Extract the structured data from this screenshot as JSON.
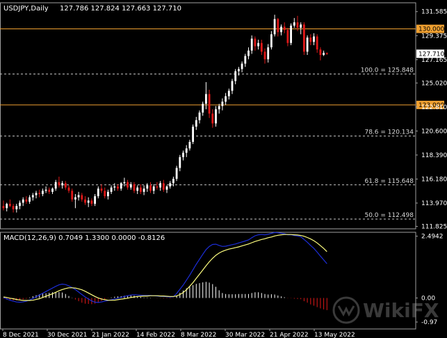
{
  "header": {
    "title": "USDJPY,Daily",
    "ohlc": "127.786 127.824 127.663 127.710"
  },
  "macd_header": "MACD(12,26,9) 0.7049 1.3300 0.0000 -0.8126",
  "watermark": "WikiFX",
  "colors": {
    "background": "#000000",
    "bull": "#ffffff",
    "bear": "#e01818",
    "hline": "#f0a030",
    "grid": "#a0a0a0",
    "macd_line": "#1c2ed8",
    "signal_line": "#ffff80",
    "hist_pos": "#ffffff",
    "hist_neg": "#e01818",
    "price_tag": "#f0a030"
  },
  "chart_data": [
    {
      "type": "candlestick",
      "symbol": "USDJPY",
      "timeframe": "Daily",
      "ylim": [
        111.6,
        132.4
      ],
      "y_ticks": [
        "131.585",
        "129.375",
        "127.165",
        "125.020",
        "122.810",
        "120.600",
        "118.390",
        "116.180",
        "113.970",
        "111.825"
      ],
      "x_ticks": [
        "8 Dec 2021",
        "30 Dec 2021",
        "21 Jan 2022",
        "14 Feb 2022",
        "8 Mar 2022",
        "30 Mar 2022",
        "21 Apr 2022",
        "13 May 2022"
      ],
      "current_price": "127.710",
      "horizontal_lines": [
        {
          "value": 130.0,
          "label": "130.000",
          "style": "solid"
        },
        {
          "value": 123.0,
          "label": "123.000",
          "style": "solid"
        }
      ],
      "fib_levels": [
        {
          "value": 125.848,
          "label": "100.0 = 125.848"
        },
        {
          "value": 120.134,
          "label": "78.6 = 120.134"
        },
        {
          "value": 115.648,
          "label": "61.8 = 115.648"
        },
        {
          "value": 112.498,
          "label": "50.0 = 112.498"
        }
      ],
      "candles": [
        [
          113.7,
          114.2,
          113.3,
          113.5
        ],
        [
          113.5,
          114.0,
          113.2,
          113.9
        ],
        [
          113.9,
          114.3,
          113.6,
          113.7
        ],
        [
          113.7,
          113.9,
          113.1,
          113.4
        ],
        [
          113.4,
          113.9,
          113.1,
          113.7
        ],
        [
          113.7,
          114.2,
          113.4,
          114.0
        ],
        [
          114.0,
          114.5,
          113.7,
          114.3
        ],
        [
          114.3,
          114.6,
          113.9,
          114.1
        ],
        [
          114.1,
          114.7,
          113.9,
          114.5
        ],
        [
          114.5,
          114.9,
          114.2,
          114.7
        ],
        [
          114.7,
          115.1,
          114.4,
          114.9
        ],
        [
          114.9,
          115.2,
          114.5,
          114.8
        ],
        [
          114.8,
          115.3,
          114.6,
          115.1
        ],
        [
          115.1,
          115.5,
          114.9,
          115.2
        ],
        [
          115.2,
          115.4,
          114.8,
          115.0
        ],
        [
          115.0,
          115.4,
          114.8,
          115.3
        ],
        [
          115.3,
          116.1,
          115.1,
          115.9
        ],
        [
          115.9,
          116.4,
          115.4,
          115.6
        ],
        [
          115.6,
          116.0,
          115.3,
          115.8
        ],
        [
          115.8,
          116.0,
          115.2,
          115.4
        ],
        [
          115.4,
          115.6,
          114.9,
          115.1
        ],
        [
          115.1,
          115.3,
          114.1,
          114.3
        ],
        [
          114.3,
          114.8,
          113.5,
          114.5
        ],
        [
          114.5,
          115.0,
          114.2,
          114.7
        ],
        [
          114.7,
          114.9,
          114.1,
          114.3
        ],
        [
          114.3,
          114.6,
          113.8,
          114.0
        ],
        [
          114.0,
          114.5,
          113.6,
          114.2
        ],
        [
          114.2,
          114.4,
          113.7,
          113.9
        ],
        [
          113.9,
          114.8,
          113.7,
          114.6
        ],
        [
          114.6,
          115.5,
          114.4,
          115.3
        ],
        [
          115.3,
          115.7,
          114.9,
          115.1
        ],
        [
          115.1,
          115.4,
          114.4,
          114.6
        ],
        [
          114.6,
          115.2,
          114.3,
          115.0
        ],
        [
          115.0,
          115.6,
          114.8,
          115.4
        ],
        [
          115.4,
          115.8,
          115.1,
          115.5
        ],
        [
          115.5,
          115.7,
          115.1,
          115.3
        ],
        [
          115.3,
          115.9,
          115.1,
          115.8
        ],
        [
          115.8,
          116.3,
          115.5,
          115.9
        ],
        [
          115.9,
          116.1,
          115.2,
          115.4
        ],
        [
          115.4,
          115.9,
          115.2,
          115.7
        ],
        [
          115.7,
          115.9,
          114.9,
          115.1
        ],
        [
          115.1,
          115.6,
          114.8,
          115.4
        ],
        [
          115.4,
          115.7,
          114.8,
          115.0
        ],
        [
          115.0,
          115.6,
          114.7,
          115.3
        ],
        [
          115.3,
          115.8,
          115.0,
          115.6
        ],
        [
          115.6,
          115.9,
          114.9,
          115.1
        ],
        [
          115.1,
          115.7,
          114.8,
          115.5
        ],
        [
          115.5,
          115.9,
          115.2,
          115.4
        ],
        [
          115.4,
          116.0,
          115.1,
          115.8
        ],
        [
          115.8,
          116.1,
          115.0,
          115.2
        ],
        [
          115.2,
          115.6,
          114.9,
          115.5
        ],
        [
          115.5,
          116.0,
          115.3,
          115.8
        ],
        [
          115.8,
          116.4,
          115.5,
          116.2
        ],
        [
          116.2,
          117.4,
          116.0,
          117.2
        ],
        [
          117.2,
          118.4,
          116.9,
          118.2
        ],
        [
          118.2,
          118.8,
          117.9,
          118.6
        ],
        [
          118.6,
          119.3,
          118.2,
          119.0
        ],
        [
          119.0,
          119.8,
          118.8,
          119.6
        ],
        [
          119.6,
          121.2,
          119.4,
          121.0
        ],
        [
          121.0,
          121.9,
          120.7,
          121.6
        ],
        [
          121.6,
          122.5,
          121.3,
          122.3
        ],
        [
          122.3,
          123.3,
          122.0,
          123.1
        ],
        [
          123.1,
          125.1,
          122.6,
          124.0
        ],
        [
          124.0,
          124.4,
          121.8,
          122.2
        ],
        [
          122.2,
          122.6,
          120.9,
          121.3
        ],
        [
          121.3,
          122.9,
          121.0,
          122.6
        ],
        [
          122.6,
          123.1,
          122.2,
          122.9
        ],
        [
          122.9,
          123.6,
          122.5,
          123.3
        ],
        [
          123.3,
          124.1,
          123.0,
          123.8
        ],
        [
          123.8,
          124.5,
          123.5,
          124.3
        ],
        [
          124.3,
          125.4,
          124.0,
          125.2
        ],
        [
          125.2,
          126.3,
          124.9,
          126.1
        ],
        [
          126.1,
          126.5,
          125.7,
          126.3
        ],
        [
          126.3,
          127.0,
          126.0,
          126.8
        ],
        [
          126.8,
          127.7,
          126.5,
          127.5
        ],
        [
          127.5,
          128.3,
          127.2,
          128.0
        ],
        [
          128.0,
          129.4,
          127.7,
          129.1
        ],
        [
          129.1,
          129.3,
          128.0,
          128.4
        ],
        [
          128.4,
          129.0,
          128.1,
          128.7
        ],
        [
          128.7,
          129.0,
          127.6,
          127.9
        ],
        [
          127.9,
          128.2,
          126.8,
          127.2
        ],
        [
          127.2,
          128.6,
          126.9,
          128.3
        ],
        [
          128.3,
          129.8,
          128.1,
          129.5
        ],
        [
          129.5,
          131.3,
          129.3,
          130.9
        ],
        [
          130.9,
          131.0,
          129.3,
          129.7
        ],
        [
          129.7,
          130.4,
          129.4,
          130.2
        ],
        [
          130.2,
          130.6,
          129.6,
          129.9
        ],
        [
          129.9,
          130.1,
          128.4,
          128.7
        ],
        [
          128.7,
          130.5,
          128.5,
          130.3
        ],
        [
          130.3,
          131.0,
          130.1,
          130.6
        ],
        [
          130.6,
          131.2,
          129.8,
          130.1
        ],
        [
          130.1,
          130.6,
          129.5,
          130.4
        ],
        [
          130.4,
          130.6,
          127.6,
          127.9
        ],
        [
          127.9,
          129.4,
          127.6,
          129.2
        ],
        [
          129.2,
          129.5,
          128.5,
          128.8
        ],
        [
          128.8,
          129.6,
          128.5,
          129.3
        ],
        [
          129.3,
          129.5,
          127.8,
          128.1
        ],
        [
          128.1,
          128.3,
          127.1,
          127.6
        ],
        [
          127.6,
          128.0,
          127.5,
          127.8
        ],
        [
          127.8,
          127.8,
          127.6,
          127.7
        ]
      ]
    },
    {
      "type": "macd",
      "params": "12,26,9",
      "ylim": [
        -1.25,
        2.65
      ],
      "y_ticks": [
        "2.4942",
        "0.00",
        "-0.97"
      ],
      "macd": [
        0.02,
        -0.04,
        -0.09,
        -0.13,
        -0.16,
        -0.17,
        -0.16,
        -0.13,
        -0.08,
        -0.02,
        0.05,
        0.12,
        0.19,
        0.26,
        0.33,
        0.4,
        0.47,
        0.53,
        0.56,
        0.54,
        0.49,
        0.42,
        0.34,
        0.24,
        0.14,
        0.04,
        -0.04,
        -0.12,
        -0.17,
        -0.18,
        -0.16,
        -0.13,
        -0.1,
        -0.07,
        -0.04,
        -0.01,
        0.02,
        0.06,
        0.09,
        0.12,
        0.13,
        0.12,
        0.11,
        0.1,
        0.1,
        0.1,
        0.09,
        0.08,
        0.07,
        0.06,
        0.05,
        0.04,
        0.05,
        0.18,
        0.35,
        0.52,
        0.72,
        0.92,
        1.14,
        1.36,
        1.56,
        1.76,
        1.95,
        2.08,
        2.16,
        2.17,
        2.12,
        2.08,
        2.09,
        2.12,
        2.15,
        2.18,
        2.22,
        2.26,
        2.3,
        2.34,
        2.43,
        2.51,
        2.55,
        2.56,
        2.55,
        2.57,
        2.61,
        2.64,
        2.63,
        2.61,
        2.59,
        2.55,
        2.55,
        2.52,
        2.5,
        2.47,
        2.36,
        2.25,
        2.12,
        2.0,
        1.85,
        1.69,
        1.54,
        1.38
      ],
      "signal": [
        0.04,
        0.02,
        -0.01,
        -0.03,
        -0.06,
        -0.08,
        -0.1,
        -0.1,
        -0.1,
        -0.09,
        -0.06,
        -0.03,
        0.02,
        0.07,
        0.12,
        0.17,
        0.23,
        0.29,
        0.34,
        0.38,
        0.41,
        0.41,
        0.4,
        0.37,
        0.33,
        0.27,
        0.2,
        0.13,
        0.06,
        0.0,
        -0.04,
        -0.07,
        -0.09,
        -0.09,
        -0.09,
        -0.07,
        -0.05,
        -0.03,
        -0.01,
        0.02,
        0.04,
        0.06,
        0.07,
        0.08,
        0.08,
        0.09,
        0.09,
        0.09,
        0.08,
        0.08,
        0.07,
        0.06,
        0.06,
        0.08,
        0.14,
        0.22,
        0.33,
        0.47,
        0.62,
        0.79,
        0.96,
        1.13,
        1.3,
        1.46,
        1.6,
        1.72,
        1.81,
        1.88,
        1.93,
        1.97,
        2.0,
        2.03,
        2.06,
        2.1,
        2.14,
        2.18,
        2.23,
        2.28,
        2.32,
        2.36,
        2.39,
        2.43,
        2.46,
        2.5,
        2.53,
        2.55,
        2.56,
        2.56,
        2.56,
        2.55,
        2.54,
        2.52,
        2.49,
        2.44,
        2.38,
        2.31,
        2.22,
        2.11,
        2.0,
        1.87
      ],
      "histogram": [
        -0.02,
        -0.06,
        -0.08,
        -0.1,
        -0.1,
        -0.09,
        -0.06,
        -0.03,
        0.02,
        0.07,
        0.11,
        0.15,
        0.17,
        0.19,
        0.21,
        0.23,
        0.24,
        0.24,
        0.22,
        0.16,
        0.08,
        0.01,
        -0.06,
        -0.13,
        -0.19,
        -0.23,
        -0.24,
        -0.25,
        -0.23,
        -0.18,
        -0.12,
        -0.06,
        -0.01,
        0.02,
        0.05,
        0.06,
        0.07,
        0.09,
        0.1,
        0.1,
        0.09,
        0.06,
        0.04,
        0.02,
        0.02,
        0.01,
        0.0,
        -0.01,
        -0.01,
        -0.02,
        -0.02,
        -0.02,
        -0.01,
        0.1,
        0.21,
        0.3,
        0.39,
        0.45,
        0.52,
        0.57,
        0.6,
        0.63,
        0.65,
        0.62,
        0.56,
        0.45,
        0.31,
        0.2,
        0.16,
        0.15,
        0.15,
        0.15,
        0.16,
        0.16,
        0.16,
        0.16,
        0.2,
        0.23,
        0.23,
        0.2,
        0.16,
        0.14,
        0.15,
        0.14,
        0.1,
        0.06,
        0.03,
        -0.01,
        -0.01,
        -0.03,
        -0.04,
        -0.05,
        -0.13,
        -0.19,
        -0.26,
        -0.31,
        -0.37,
        -0.42,
        -0.46,
        -0.49
      ]
    }
  ]
}
